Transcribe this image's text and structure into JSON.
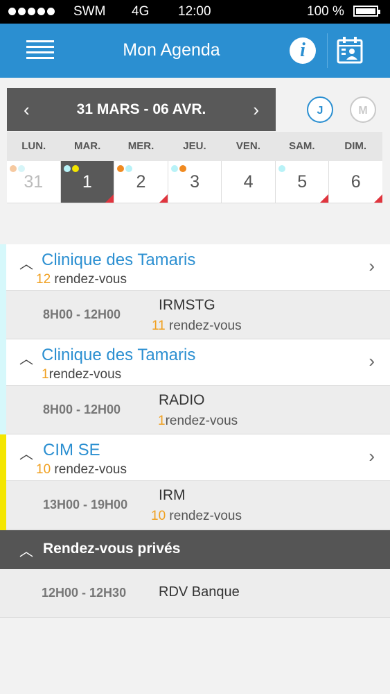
{
  "status_bar": {
    "carrier": "SWM",
    "network": "4G",
    "time": "12:00",
    "battery": "100 %"
  },
  "header": {
    "title": "Mon Agenda",
    "menu_icon": "hamburger-icon",
    "info_icon": "info-icon",
    "calendar_icon": "calendar-user-icon"
  },
  "week": {
    "range": "31 MARS - 06 AVR.",
    "prev": "‹",
    "next": "›"
  },
  "view_toggle": {
    "day": "J",
    "month": "M"
  },
  "day_headers": [
    "LUN.",
    "MAR.",
    "MER.",
    "JEU.",
    "VEN.",
    "SAM.",
    "DIM."
  ],
  "days": [
    "31",
    "1",
    "2",
    "3",
    "4",
    "5",
    "6"
  ],
  "colors": {
    "accent": "#2b8fd1",
    "header_bg": "#2b8fd1",
    "dark": "#555555",
    "orange": "#f0a020",
    "cyan": "#b8f2f7",
    "yellow": "#f4e600",
    "red": "#e0353e"
  },
  "groups": [
    {
      "name": "Clinique des Tamaris",
      "count": "12",
      "count_label": "rendez-vous",
      "stripe": "#b8f2f7",
      "row": {
        "time": "8H00 - 12H00",
        "name": "IRMSTG",
        "count": "11",
        "count_label": "rendez-vous"
      }
    },
    {
      "name": "Clinique des Tamaris",
      "count": "1",
      "count_label": "rendez-vous",
      "stripe": "#b8f2f7",
      "row": {
        "time": "8H00 - 12H00",
        "name": "RADIO",
        "count": "1",
        "count_label": "rendez-vous"
      }
    },
    {
      "name": "CIM SE",
      "count": "10",
      "count_label": "rendez-vous",
      "stripe": "#f4e600",
      "row": {
        "time": "13H00 - 19H00",
        "name": "IRM",
        "count": "10",
        "count_label": "rendez-vous"
      }
    }
  ],
  "private": {
    "label": "Rendez-vous privés",
    "time": "12H00 - 12H30",
    "name": "RDV Banque"
  }
}
